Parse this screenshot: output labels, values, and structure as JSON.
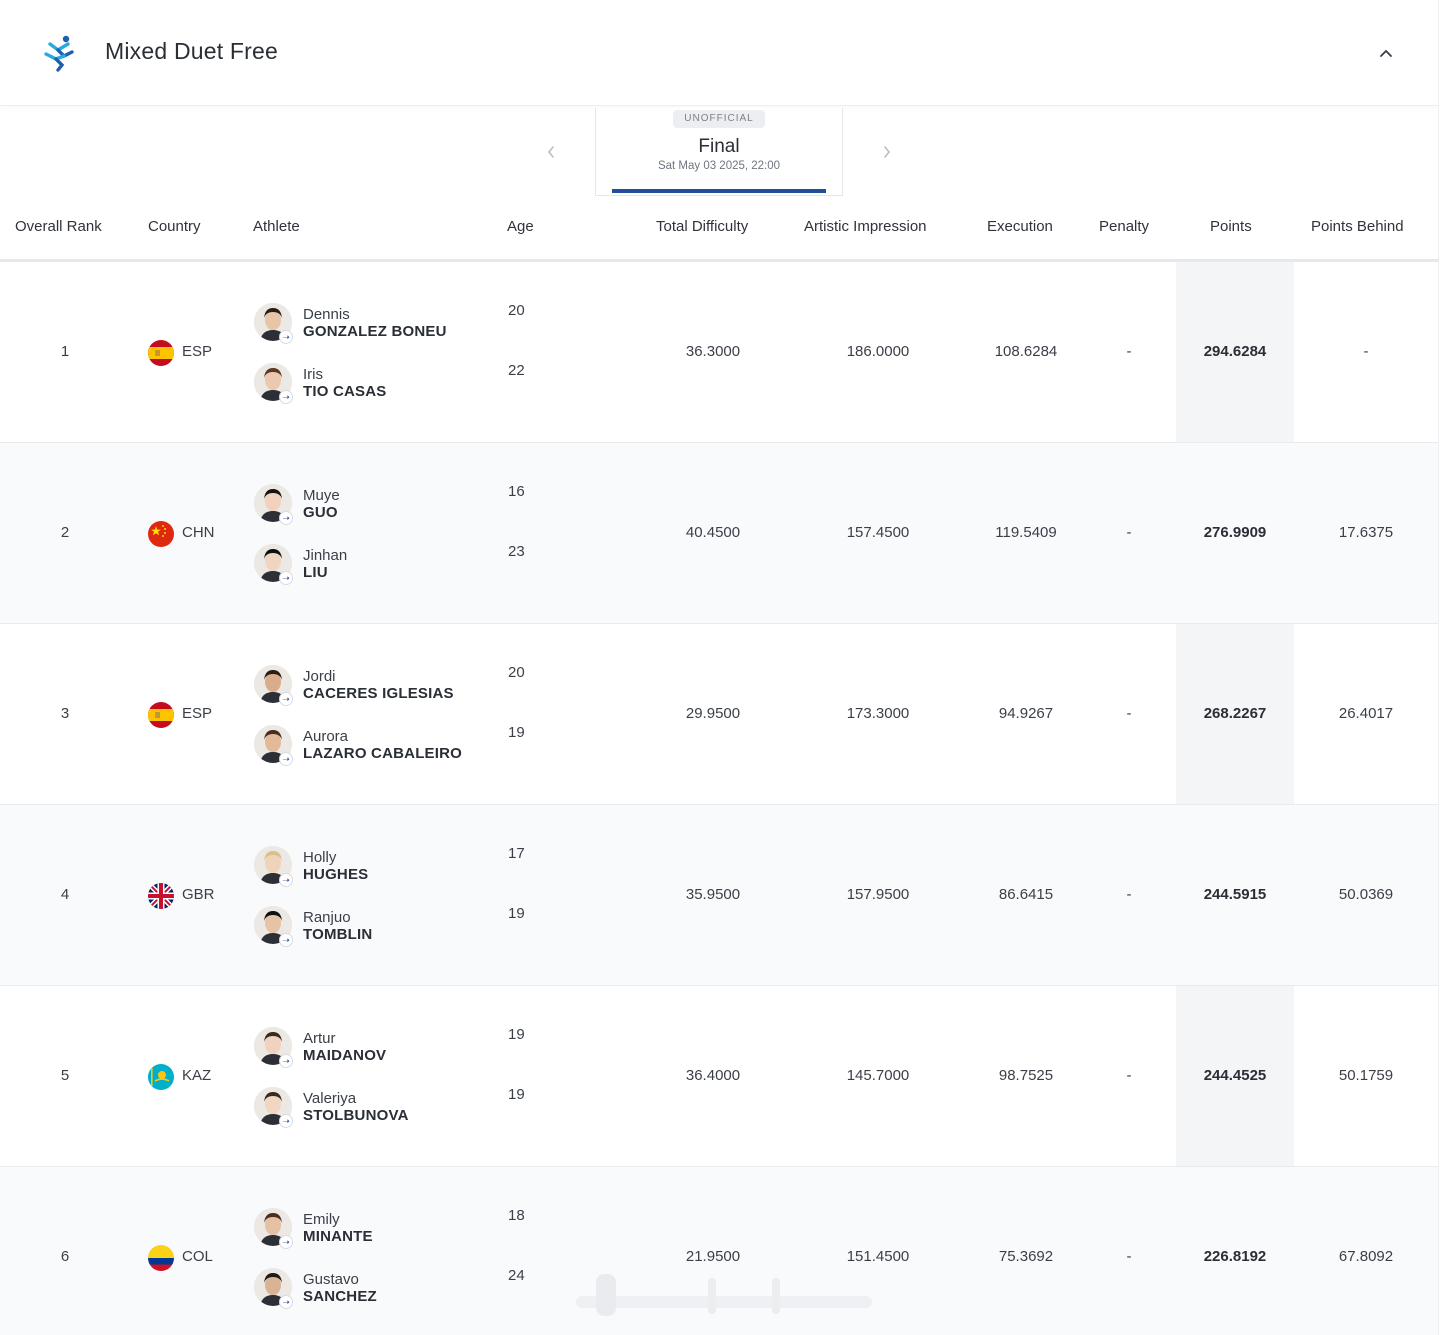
{
  "header": {
    "title": "Mixed Duet Free",
    "logo_icon": "artistic-swimming-icon",
    "collapse_icon": "chevron-up-icon"
  },
  "phase": {
    "status_badge": "UNOFFICIAL",
    "name": "Final",
    "date": "Sat May 03 2025, 22:00",
    "accent_color": "#1f4e9a"
  },
  "columns": {
    "rank": "Overall Rank",
    "country": "Country",
    "athlete": "Athlete",
    "age": "Age",
    "total_difficulty": "Total Difficulty",
    "artistic_impression": "Artistic Impression",
    "execution": "Execution",
    "penalty": "Penalty",
    "points": "Points",
    "points_behind": "Points Behind"
  },
  "rows": [
    {
      "rank": "1",
      "flag": "flag-esp",
      "country": "ESP",
      "a1_first": "Dennis",
      "a1_last": "GONZALEZ BONEU",
      "a1_age": "20",
      "a2_first": "Iris",
      "a2_last": "TIO CASAS",
      "a2_age": "22",
      "td": "36.3000",
      "ai": "186.0000",
      "ex": "108.6284",
      "pen": "-",
      "pts": "294.6284",
      "pb": "-"
    },
    {
      "rank": "2",
      "flag": "flag-chn",
      "country": "CHN",
      "a1_first": "Muye",
      "a1_last": "GUO",
      "a1_age": "16",
      "a2_first": "Jinhan",
      "a2_last": "LIU",
      "a2_age": "23",
      "td": "40.4500",
      "ai": "157.4500",
      "ex": "119.5409",
      "pen": "-",
      "pts": "276.9909",
      "pb": "17.6375"
    },
    {
      "rank": "3",
      "flag": "flag-esp",
      "country": "ESP",
      "a1_first": "Jordi",
      "a1_last": "CACERES IGLESIAS",
      "a1_age": "20",
      "a2_first": "Aurora",
      "a2_last": "LAZARO CABALEIRO",
      "a2_age": "19",
      "td": "29.9500",
      "ai": "173.3000",
      "ex": "94.9267",
      "pen": "-",
      "pts": "268.2267",
      "pb": "26.4017"
    },
    {
      "rank": "4",
      "flag": "flag-gbr",
      "country": "GBR",
      "a1_first": "Holly",
      "a1_last": "HUGHES",
      "a1_age": "17",
      "a2_first": "Ranjuo",
      "a2_last": "TOMBLIN",
      "a2_age": "19",
      "td": "35.9500",
      "ai": "157.9500",
      "ex": "86.6415",
      "pen": "-",
      "pts": "244.5915",
      "pb": "50.0369"
    },
    {
      "rank": "5",
      "flag": "flag-kaz",
      "country": "KAZ",
      "a1_first": "Artur",
      "a1_last": "MAIDANOV",
      "a1_age": "19",
      "a2_first": "Valeriya",
      "a2_last": "STOLBUNOVA",
      "a2_age": "19",
      "td": "36.4000",
      "ai": "145.7000",
      "ex": "98.7525",
      "pen": "-",
      "pts": "244.4525",
      "pb": "50.1759"
    },
    {
      "rank": "6",
      "flag": "flag-col",
      "country": "COL",
      "a1_first": "Emily",
      "a1_last": "MINANTE",
      "a1_age": "18",
      "a2_first": "Gustavo",
      "a2_last": "SANCHEZ",
      "a2_age": "24",
      "td": "21.9500",
      "ai": "151.4500",
      "ex": "75.3692",
      "pen": "-",
      "pts": "226.8192",
      "pb": "67.8092"
    }
  ]
}
